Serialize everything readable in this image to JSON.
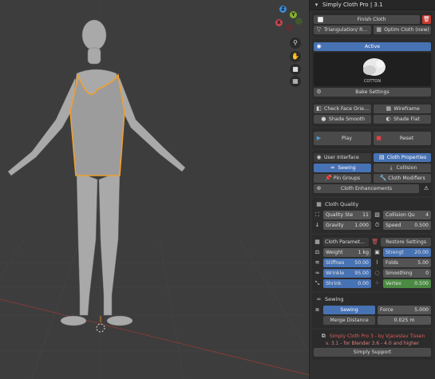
{
  "panel": {
    "title": "Simply Cloth Pro | 3.1",
    "finish_cloth": "Finish Cloth",
    "triangulation": "Triangulation/ Reme...",
    "optim_cloth": "Optim Cloth (new)",
    "active": "Active",
    "material_label": "COTTON",
    "bake_settings": "Bake Settings",
    "check_face_orientation": "Check Face Orienta...",
    "wireframe": "Wireframe",
    "shade_smooth": "Shade Smooth",
    "shade_flat": "Shade Flat",
    "play": "Play",
    "reset": "Reset",
    "ui": {
      "user_interface": "User Interface",
      "cloth_properties": "Cloth Properties",
      "sewing": "Sewing",
      "collision": "Collision",
      "pin_groups": "Pin Groups",
      "cloth_modifiers": "Cloth Modifiers",
      "cloth_enhancements": "Cloth Enhancements"
    },
    "quality": {
      "header": "Cloth Quality",
      "quality_steps_label": "Quality Ste",
      "quality_steps_value": "11",
      "collision_quality_label": "Collision Qu",
      "collision_quality_value": "4",
      "gravity_label": "Gravity",
      "gravity_value": "1.000",
      "speed_label": "Speed",
      "speed_value": "0.500"
    },
    "params": {
      "header": "Cloth Paramet...",
      "restore": "Restore Settings",
      "weight_label": "Weight",
      "weight_value": "1 kg",
      "strength_label": "Strengt",
      "strength_value": "20.00",
      "stiffness_label": "Stiffnes",
      "stiffness_value": "50.00",
      "folds_label": "Folds",
      "folds_value": "5.00",
      "wrinkle_label": "Wrinkle",
      "wrinkle_value": "95.00",
      "smoothing_label": "Smoothing",
      "smoothing_value": "0",
      "shrink_label": "Shrink",
      "shrink_value": "0.00",
      "vertex_label": "Vertex",
      "vertex_value": "0.500"
    },
    "sewing": {
      "header": "Sewing",
      "sewing_btn": "Sewing",
      "force_label": "Force",
      "force_value": "5.000",
      "merge_label": "Merge Distance",
      "merge_value": "0.025 m"
    },
    "credits": {
      "line1": "Simply Cloth Pro 3 - by Vjaceslav Tissen",
      "line2": "v. 3.1 - for Blender 3.6 - 4.0 and higher",
      "support": "Simply Support"
    }
  },
  "viewport": {
    "gizmo": {
      "z": "Z",
      "y": "Y",
      "x": "X"
    }
  },
  "colors": {
    "accent_blue": "#4772b3",
    "accent_green": "#4b8a43",
    "selection_orange": "#f0a030",
    "credit_red": "#e05a5a"
  }
}
